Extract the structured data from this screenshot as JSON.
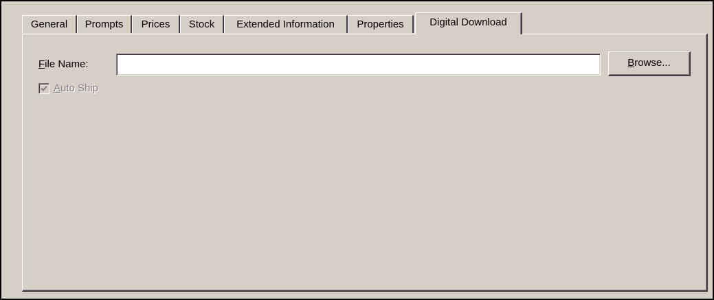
{
  "tabs": [
    {
      "label": "General",
      "active": false
    },
    {
      "label": "Prompts",
      "active": false
    },
    {
      "label": "Prices",
      "active": false
    },
    {
      "label": "Stock",
      "active": false
    },
    {
      "label": "Extended Information",
      "active": false
    },
    {
      "label": "Properties",
      "active": false
    },
    {
      "label": "Digital Download",
      "active": true
    }
  ],
  "form": {
    "file_name_label_mnemonic": "F",
    "file_name_label_rest": "ile Name:",
    "file_name_value": "",
    "browse_mnemonic": "B",
    "browse_rest": "rowse...",
    "auto_ship_mnemonic": "A",
    "auto_ship_rest": "uto Ship",
    "auto_ship_checked": true,
    "auto_ship_enabled": false
  },
  "icons": {
    "checkmark": "checkmark-icon"
  },
  "colors": {
    "face": "#d4d0c8",
    "disabled_text": "#808080",
    "field_bg": "#ffffff"
  }
}
